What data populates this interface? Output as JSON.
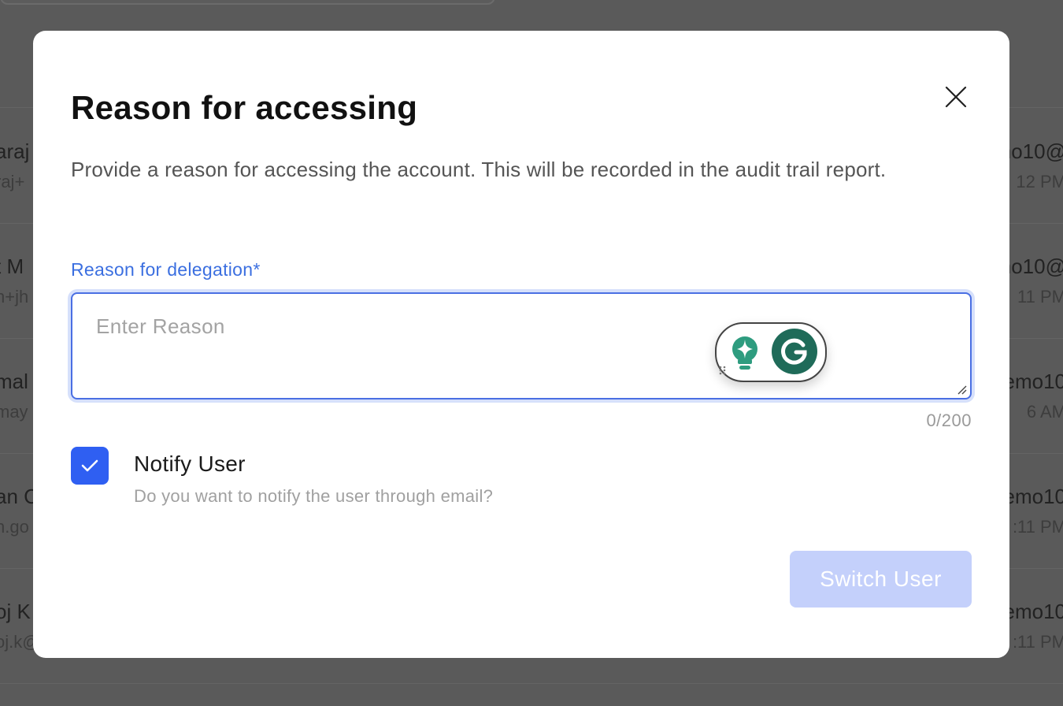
{
  "background": {
    "rows": [
      {
        "left_name": "araj",
        "left_sub": "raj+",
        "right_email": "no10@",
        "right_time": "12 PM"
      },
      {
        "left_name": "t M",
        "left_sub": "n+jh",
        "right_email": "no10@",
        "right_time": "11 PM"
      },
      {
        "left_name": "mal",
        "left_sub": "may",
        "right_email": "emo10",
        "right_time": "6 AM"
      },
      {
        "left_name": "an C",
        "left_sub": "n.go",
        "right_email": "emo10",
        "right_time": ":11 PM"
      },
      {
        "left_name": "oj K",
        "left_sub": "oj.k@",
        "right_email": "emo10",
        "right_time": ":11 PM"
      }
    ]
  },
  "modal": {
    "title": "Reason for accessing",
    "close_icon": "close-icon",
    "description": "Provide a reason for accessing the account. This will be recorded in the audit trail report.",
    "reason_field": {
      "label": "Reason for delegation*",
      "placeholder": "Enter Reason",
      "value": "",
      "counter": "0/200"
    },
    "notify": {
      "checked": true,
      "title": "Notify User",
      "subtitle": "Do you want to notify the user through email?"
    },
    "submit_label": "Switch User"
  },
  "colors": {
    "accent": "#2f5ff2",
    "label_blue": "#3b6fe0",
    "button_disabled": "#c4d0fb",
    "grammarly_green": "#1f6b59"
  }
}
